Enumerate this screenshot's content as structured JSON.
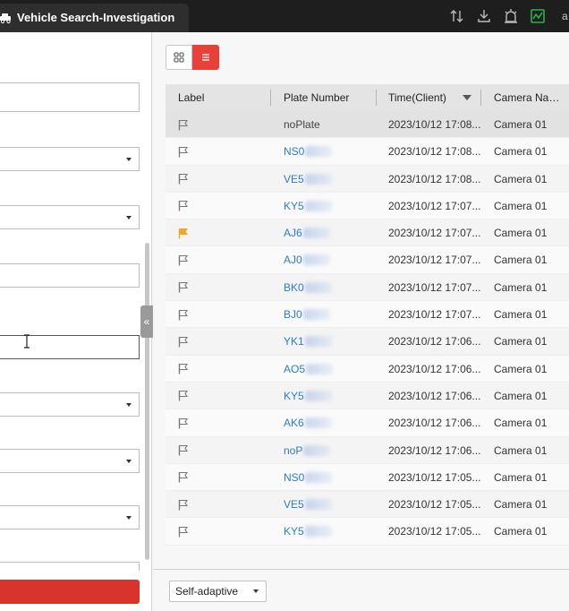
{
  "window": {
    "title": "Vehicle Search-Investigation",
    "user_initial": "a"
  },
  "toolbar": {
    "icons": [
      "sort-icon",
      "download-icon",
      "alarm-icon",
      "monitor-icon"
    ],
    "accent": "#27b34a"
  },
  "left_panel": {
    "collapse_glyph": "«"
  },
  "view": {
    "modes": [
      "grid-view-icon",
      "list-view-icon"
    ],
    "active": "list"
  },
  "table": {
    "columns": [
      "Label",
      "Plate Number",
      "Time(Client)",
      "Camera Na…"
    ],
    "rows": [
      {
        "flagged": false,
        "plate": "noPlate",
        "time": "2023/10/12 17:08...",
        "camera": "Camera 01"
      },
      {
        "flagged": false,
        "plate": "NS0",
        "time": "2023/10/12 17:08...",
        "camera": "Camera 01"
      },
      {
        "flagged": false,
        "plate": "VE5",
        "time": "2023/10/12 17:08...",
        "camera": "Camera 01"
      },
      {
        "flagged": false,
        "plate": "KY5",
        "time": "2023/10/12 17:07...",
        "camera": "Camera 01"
      },
      {
        "flagged": true,
        "plate": "AJ6",
        "time": "2023/10/12 17:07...",
        "camera": "Camera 01"
      },
      {
        "flagged": false,
        "plate": "AJ0",
        "time": "2023/10/12 17:07...",
        "camera": "Camera 01"
      },
      {
        "flagged": false,
        "plate": "BK0",
        "time": "2023/10/12 17:07...",
        "camera": "Camera 01"
      },
      {
        "flagged": false,
        "plate": "BJ0",
        "time": "2023/10/12 17:07...",
        "camera": "Camera 01"
      },
      {
        "flagged": false,
        "plate": "YK1",
        "time": "2023/10/12 17:06...",
        "camera": "Camera 01"
      },
      {
        "flagged": false,
        "plate": "AO5",
        "time": "2023/10/12 17:06...",
        "camera": "Camera 01"
      },
      {
        "flagged": false,
        "plate": "KY5",
        "time": "2023/10/12 17:06...",
        "camera": "Camera 01"
      },
      {
        "flagged": false,
        "plate": "AK6",
        "time": "2023/10/12 17:06...",
        "camera": "Camera 01"
      },
      {
        "flagged": false,
        "plate": "noP",
        "time": "2023/10/12 17:06...",
        "camera": "Camera 01"
      },
      {
        "flagged": false,
        "plate": "NS0",
        "time": "2023/10/12 17:05...",
        "camera": "Camera 01"
      },
      {
        "flagged": false,
        "plate": "VE5",
        "time": "2023/10/12 17:05...",
        "camera": "Camera 01"
      },
      {
        "flagged": false,
        "plate": "KY5",
        "time": "2023/10/12 17:05...",
        "camera": "Camera 01"
      }
    ]
  },
  "footer": {
    "page_size": "Self-adaptive"
  },
  "colors": {
    "flag_active": "#f5a623",
    "flag_idle": "#777777",
    "link": "#2b7bd4",
    "accent_red": "#e8413a"
  }
}
